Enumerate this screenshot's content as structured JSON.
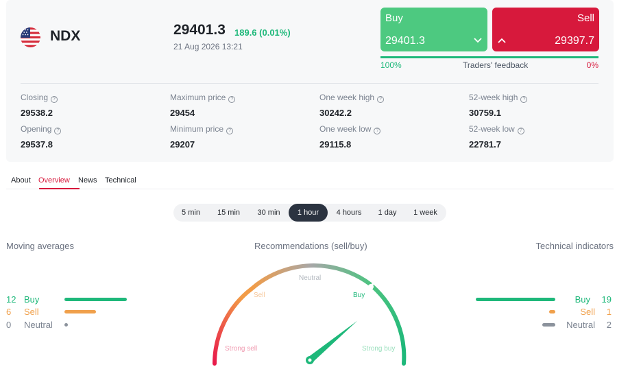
{
  "instrument": {
    "symbol": "NDX",
    "flag_icon": "us-flag-icon",
    "price": "29401.3",
    "change": "189.6 (0.01%)",
    "datetime": "21 Aug 2026 13:21"
  },
  "trade": {
    "buy_label": "Buy",
    "buy_price": "29401.3",
    "sell_label": "Sell",
    "sell_price": "29397.7",
    "buy_color": "#4dc980",
    "sell_color": "#d7193c"
  },
  "feedback": {
    "buy_pct_label": "100%",
    "sell_pct_label": "0%",
    "label": "Traders' feedback",
    "buy_fraction": 1.0
  },
  "stats": [
    {
      "label": "Closing",
      "value": "29538.2"
    },
    {
      "label": "Maximum price",
      "value": "29454"
    },
    {
      "label": "One week high",
      "value": "30242.2"
    },
    {
      "label": "52-week high",
      "value": "30759.1"
    },
    {
      "label": "Opening",
      "value": "29537.8"
    },
    {
      "label": "Minimum price",
      "value": "29207"
    },
    {
      "label": "One week low",
      "value": "29115.8"
    },
    {
      "label": "52-week low",
      "value": "22781.7"
    }
  ],
  "tabs": [
    "About",
    "Overview",
    "News",
    "Technical"
  ],
  "active_tab": "Overview",
  "timeframes": [
    "5 min",
    "15 min",
    "30 min",
    "1 hour",
    "4 hours",
    "1 day",
    "1 week"
  ],
  "active_timeframe": "1 hour",
  "sections": {
    "moving_averages": "Moving averages",
    "recommendations": "Recommendations (sell/buy)",
    "technical_indicators": "Technical indicators"
  },
  "moving_averages": {
    "buy": {
      "count": "12",
      "label": "Buy",
      "fraction": 1.0
    },
    "sell": {
      "count": "6",
      "label": "Sell",
      "fraction": 0.5
    },
    "neutral": {
      "count": "0",
      "label": "Neutral",
      "fraction": 0.0
    }
  },
  "technical_indicators": {
    "buy": {
      "count": "19",
      "label": "Buy",
      "fraction": 1.0
    },
    "sell": {
      "count": "1",
      "label": "Sell",
      "fraction": 0.08
    },
    "neutral": {
      "count": "2",
      "label": "Neutral",
      "fraction": 0.16
    }
  },
  "gauge": {
    "labels": {
      "strong_sell": "Strong sell",
      "sell": "Sell",
      "neutral": "Neutral",
      "buy": "Buy",
      "strong_buy": "Strong buy"
    },
    "needle_value": 0.78
  },
  "colors": {
    "buy": "#1eb87a",
    "sell": "#f0a04b",
    "neutral": "#8b929c",
    "accent": "#d7193c"
  }
}
